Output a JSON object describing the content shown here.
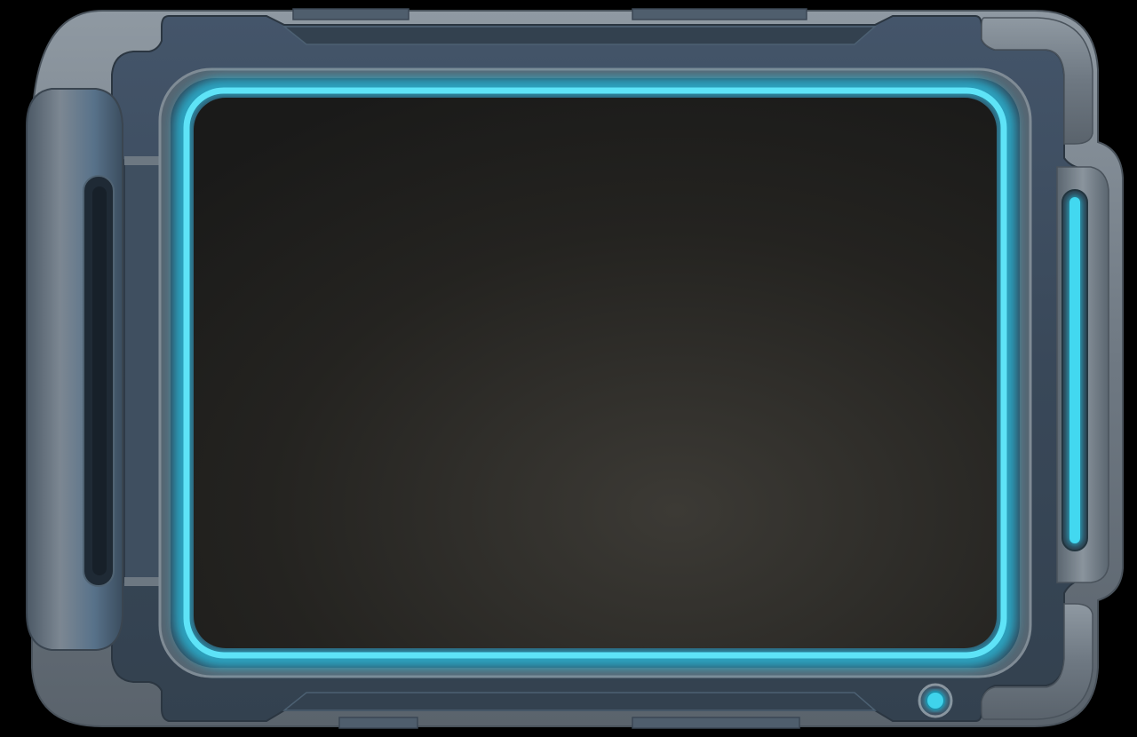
{
  "panel": {
    "accent_color": "#29c6e6",
    "screen_color": "#1e1d1b",
    "body_color": "#3c4c5d",
    "trim_color": "#7c8690",
    "icons": {
      "power_button": "circle-button-icon",
      "left_handle": "handle-grip-icon",
      "right_light": "light-bar-icon"
    }
  }
}
